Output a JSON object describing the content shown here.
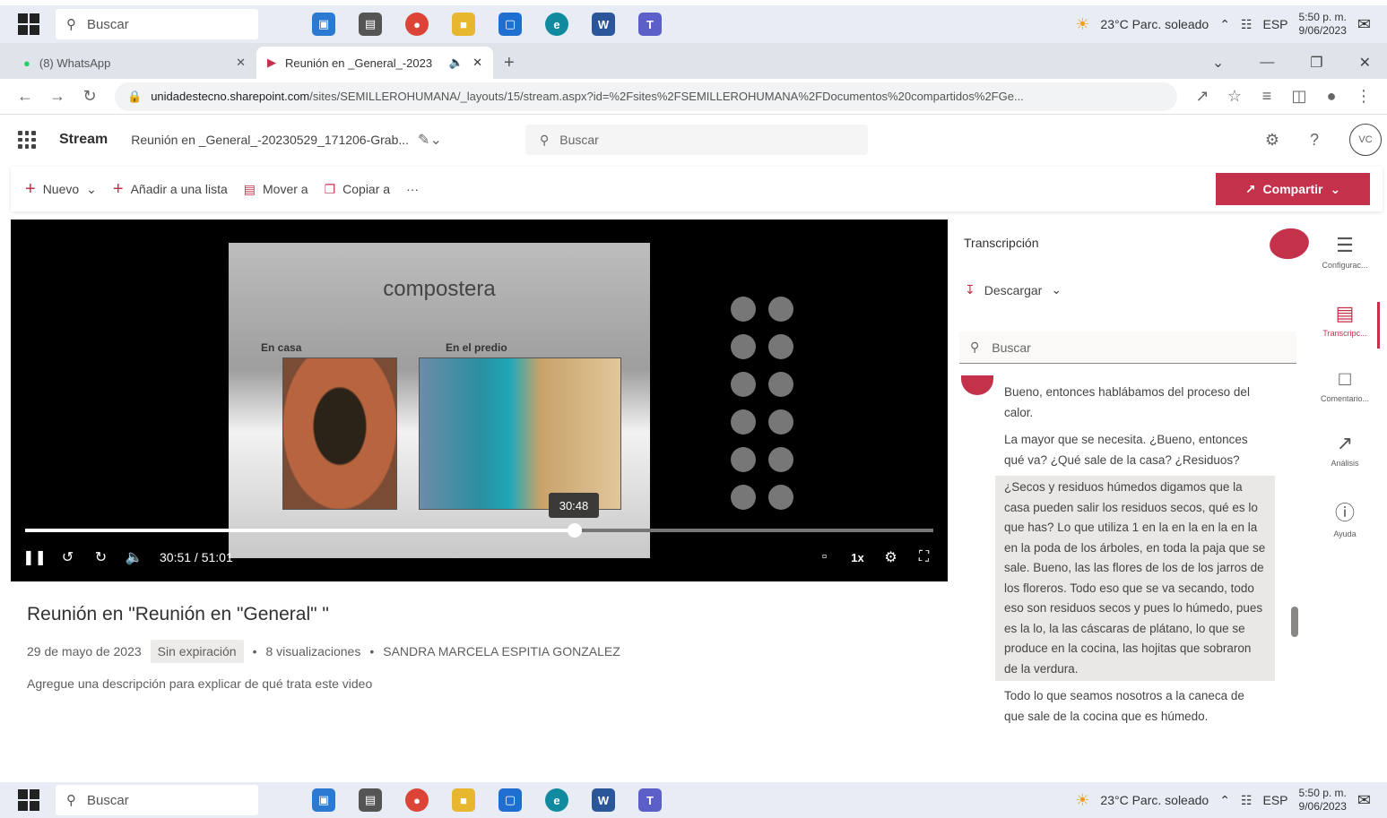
{
  "taskbar": {
    "search_placeholder": "Buscar",
    "weather": "23°C  Parc. soleado",
    "language": "ESP",
    "time": "5:50 p. m.",
    "date": "9/06/2023"
  },
  "browser": {
    "tabs": [
      {
        "label": "(8) WhatsApp"
      },
      {
        "label": "Reunión en _General_-2023"
      }
    ],
    "url_domain": "unidadestecno.sharepoint.com",
    "url_path": "/sites/SEMILLEROHUMANA/_layouts/15/stream.aspx?id=%2Fsites%2FSEMILLEROHUMANA%2FDocumentos%20compartidos%2FGe..."
  },
  "header": {
    "brand": "Stream",
    "doc_title": "Reunión en _General_-20230529_171206-Grab...",
    "search_placeholder": "Buscar",
    "avatar_initials": "VC"
  },
  "commands": {
    "new": "Nuevo",
    "add_to_list": "Añadir a una lista",
    "move_to": "Mover a",
    "copy_to": "Copiar a",
    "more": "···",
    "share": "Compartir"
  },
  "video": {
    "slide_title": "compostera",
    "label_left": "En casa",
    "label_right": "En el predio",
    "hover_time": "30:48",
    "current_time": "30:51",
    "duration": "51:01",
    "progress_fraction": 0.605,
    "speed": "1x"
  },
  "info": {
    "title": "Reunión en \"Reunión en \"General\" \"",
    "date": "29 de mayo de 2023",
    "expiry": "Sin expiración",
    "views": "8 visualizaciones",
    "author": "SANDRA MARCELA ESPITIA GONZALEZ",
    "description_placeholder": "Agregue una descripción para explicar de qué trata este video"
  },
  "transcript": {
    "title": "Transcripción",
    "download": "Descargar",
    "search_placeholder": "Buscar",
    "entries": [
      "Bueno, entonces hablábamos del proceso del calor.",
      "La mayor que se necesita. ¿Bueno, entonces qué va? ¿Qué sale de la casa? ¿Residuos?",
      "¿Secos y residuos húmedos digamos que la casa pueden salir los residuos secos, qué es lo que has? Lo que utiliza 1 en la en la en la en la en la poda de los árboles, en toda la paja que se sale. Bueno, las las flores de los de los jarros de los floreros. Todo eso que se va secando, todo eso son residuos secos y pues lo húmedo, pues es la lo, la las cáscaras de plátano, lo que se produce en la cocina, las hojitas que sobraron de la verdura.",
      "Todo lo que seamos nosotros a la caneca de que sale de la cocina que es húmedo."
    ]
  },
  "rail": {
    "settings": "Configurac...",
    "transcript": "Transcripc...",
    "comments": "Comentario...",
    "analytics": "Análisis",
    "help": "Ayuda"
  },
  "colors": {
    "accent": "#c4314b",
    "taskbar": "#e8edf5"
  }
}
